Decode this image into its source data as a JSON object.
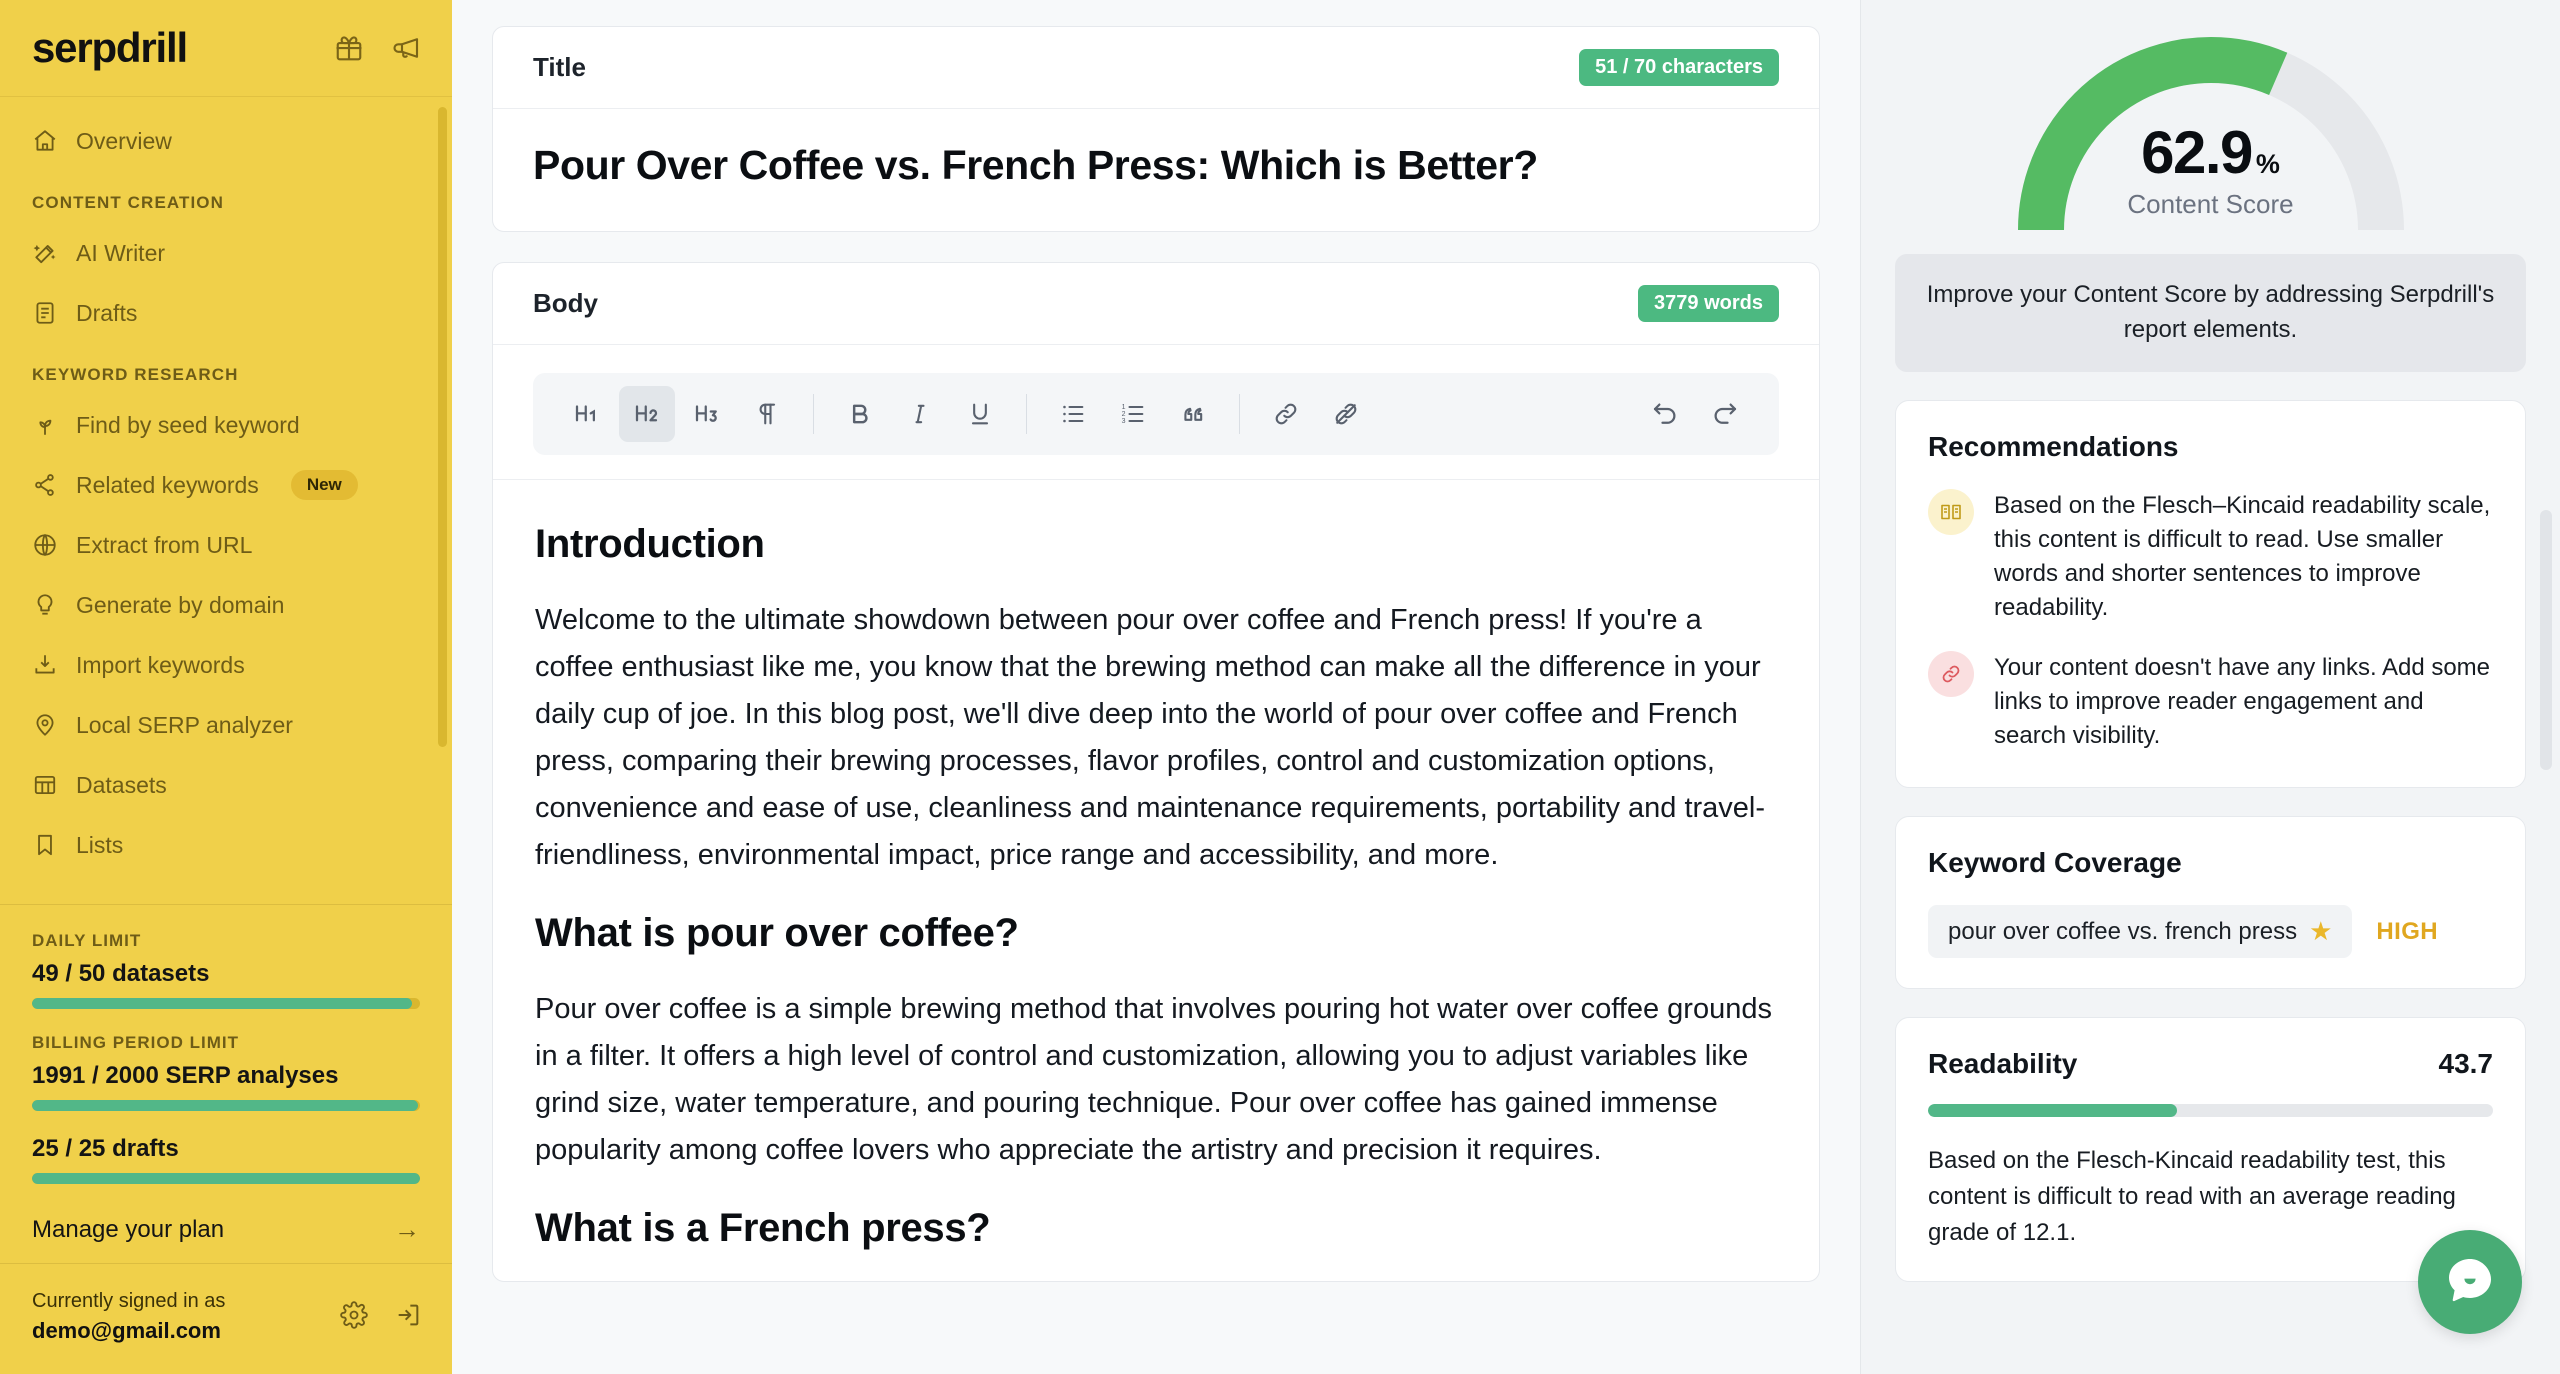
{
  "brand": {
    "name": "serpdrill",
    "accent": "#f0d04a",
    "green": "#4cb981"
  },
  "sidebar": {
    "header_icons": [
      {
        "name": "gift-icon",
        "label": "Gift"
      },
      {
        "name": "megaphone-icon",
        "label": "Announcements"
      }
    ],
    "top_items": [
      {
        "label": "Overview",
        "icon": "home-icon"
      }
    ],
    "sections": [
      {
        "title": "CONTENT CREATION",
        "items": [
          {
            "label": "AI Writer",
            "icon": "magic-wand-icon"
          },
          {
            "label": "Drafts",
            "icon": "document-icon"
          }
        ]
      },
      {
        "title": "KEYWORD RESEARCH",
        "items": [
          {
            "label": "Find by seed keyword",
            "icon": "sprout-icon"
          },
          {
            "label": "Related keywords",
            "icon": "network-icon",
            "badge": "New"
          },
          {
            "label": "Extract from URL",
            "icon": "globe-icon"
          },
          {
            "label": "Generate by domain",
            "icon": "lightbulb-icon"
          },
          {
            "label": "Import keywords",
            "icon": "import-icon"
          },
          {
            "label": "Local SERP analyzer",
            "icon": "map-pin-icon"
          },
          {
            "label": "Datasets",
            "icon": "table-icon"
          },
          {
            "label": "Lists",
            "icon": "bookmark-icon"
          }
        ]
      }
    ],
    "limits": [
      {
        "label": "DAILY LIMIT",
        "value": "49 / 50 datasets",
        "percent": 98
      },
      {
        "label": "BILLING PERIOD LIMIT",
        "value": "1991 / 2000 SERP analyses",
        "percent": 99.6
      },
      {
        "label": "",
        "value": "25 / 25 drafts",
        "percent": 100
      }
    ],
    "manage_plan": "Manage your plan",
    "signed_in_label": "Currently signed in as",
    "signed_in_email": "demo@gmail.com",
    "footer_icons": [
      {
        "name": "gear-icon",
        "label": "Settings"
      },
      {
        "name": "logout-icon",
        "label": "Sign out"
      }
    ]
  },
  "editor": {
    "title_card": {
      "label": "Title",
      "counter": "51 / 70 characters",
      "value": "Pour Over Coffee vs. French Press: Which is Better?"
    },
    "body_card": {
      "label": "Body",
      "counter": "3779 words"
    },
    "toolbar": [
      {
        "name": "heading-1-button",
        "glyph": "H1",
        "active": false
      },
      {
        "name": "heading-2-button",
        "glyph": "H2",
        "active": true
      },
      {
        "name": "heading-3-button",
        "glyph": "H3",
        "active": false
      },
      {
        "name": "paragraph-button",
        "glyph": "¶",
        "active": false
      },
      {
        "name": "bold-button",
        "glyph": "B",
        "active": false
      },
      {
        "name": "italic-button",
        "glyph": "I",
        "active": false
      },
      {
        "name": "underline-button",
        "glyph": "U",
        "active": false
      },
      {
        "name": "bullet-list-button",
        "glyph": "list",
        "active": false
      },
      {
        "name": "numbered-list-button",
        "glyph": "olist",
        "active": false
      },
      {
        "name": "blockquote-button",
        "glyph": "quote",
        "active": false
      },
      {
        "name": "link-button",
        "glyph": "link",
        "active": false
      },
      {
        "name": "unlink-button",
        "glyph": "unlink",
        "active": false
      },
      {
        "name": "undo-button",
        "glyph": "undo",
        "active": false
      },
      {
        "name": "redo-button",
        "glyph": "redo",
        "active": false
      }
    ],
    "document": {
      "h_intro": "Introduction",
      "p_intro": "Welcome to the ultimate showdown between pour over coffee and French press! If you're a coffee enthusiast like me, you know that the brewing method can make all the difference in your daily cup of joe. In this blog post, we'll dive deep into the world of pour over coffee and French press, comparing their brewing processes, flavor profiles, control and customization options, convenience and ease of use, cleanliness and maintenance requirements, portability and travel-friendliness, environmental impact, price range and accessibility, and more.",
      "h_pourover": "What is pour over coffee?",
      "p_pourover": "Pour over coffee is a simple brewing method that involves pouring hot water over coffee grounds in a filter. It offers a high level of control and customization, allowing you to adjust variables like grind size, water temperature, and pouring technique. Pour over coffee has gained immense popularity among coffee lovers who appreciate the artistry and precision it requires.",
      "h_frenchpress": "What is a French press?"
    }
  },
  "report": {
    "gauge": {
      "value": "62.9",
      "percent_symbol": "%",
      "caption": "Content Score",
      "percent": 62.9,
      "track_color": "#e6e8eb",
      "fill_color": "#55bb63"
    },
    "improve_note": "Improve your Content Score by addressing Serpdrill's report elements.",
    "recommendations": {
      "title": "Recommendations",
      "items": [
        {
          "icon": "book-icon",
          "tone": "yellow",
          "text": "Based on the Flesch–Kincaid readability scale, this content is difficult to read. Use smaller words and shorter sentences to improve readability."
        },
        {
          "icon": "link-icon",
          "tone": "red",
          "text": "Your content doesn't have any links. Add some links to improve reader engagement and search visibility."
        }
      ]
    },
    "keyword_coverage": {
      "title": "Keyword Coverage",
      "keyword": "pour over coffee vs. french press",
      "level": "HIGH"
    },
    "readability": {
      "title": "Readability",
      "score": "43.7",
      "percent": 44,
      "text": "Based on the Flesch-Kincaid readability test, this content is difficult to read with an average reading grade of 12.1."
    },
    "chat_widget": {
      "name": "chat-bubble-icon",
      "color": "#48ac75"
    }
  }
}
